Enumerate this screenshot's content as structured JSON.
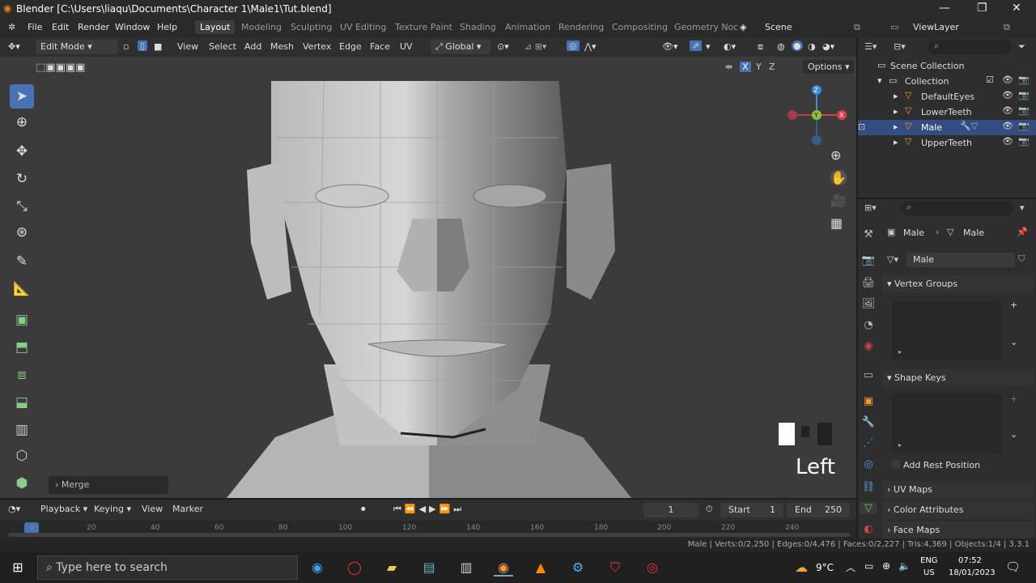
{
  "window": {
    "title": "Blender [C:\\Users\\liaqu\\Documents\\Character 1\\Male1\\Tut.blend]",
    "minimize": "—",
    "maximize": "❐",
    "close": "✕"
  },
  "menu": [
    "File",
    "Edit",
    "Render",
    "Window",
    "Help"
  ],
  "workspaces": [
    "Layout",
    "Modeling",
    "Sculpting",
    "UV Editing",
    "Texture Paint",
    "Shading",
    "Animation",
    "Rendering",
    "Compositing",
    "Geometry Noc"
  ],
  "scene": "Scene",
  "view_layer": "ViewLayer",
  "header3d": {
    "mode": "Edit Mode",
    "menus": [
      "View",
      "Select",
      "Add",
      "Mesh",
      "Vertex",
      "Edge",
      "Face",
      "UV"
    ],
    "transform": "Global",
    "options": "Options",
    "x": "X",
    "y": "Y",
    "z": "Z"
  },
  "viewport": {
    "view_label": "Left",
    "operator": "Merge"
  },
  "outliner": {
    "root": "Scene Collection",
    "collection": "Collection",
    "items": [
      {
        "name": "DefaultEyes"
      },
      {
        "name": "LowerTeeth"
      },
      {
        "name": "Male"
      },
      {
        "name": "UpperTeeth"
      }
    ]
  },
  "properties": {
    "breadcrumb_object": "Male",
    "breadcrumb_data": "Male",
    "mesh_name": "Male",
    "panels": [
      "Vertex Groups",
      "Shape Keys",
      "UV Maps",
      "Color Attributes",
      "Face Maps"
    ],
    "add_rest_position": "Add Rest Position"
  },
  "timeline": {
    "menus": [
      "Playback",
      "Keying",
      "View",
      "Marker"
    ],
    "current_frame": "1",
    "start_label": "Start",
    "start": "1",
    "end_label": "End",
    "end": "250",
    "ticks": [
      "0",
      "20",
      "40",
      "60",
      "80",
      "100",
      "120",
      "140",
      "160",
      "180",
      "200",
      "220",
      "240"
    ]
  },
  "status": "Male | Verts:0/2,250 | Edges:0/4,476 | Faces:0/2,227 | Tris:4,369 | Objects:1/4 | 3.3.1",
  "taskbar": {
    "search_placeholder": "Type here to search",
    "temperature": "9°C",
    "lang_top": "ENG",
    "lang_bottom": "US",
    "time": "07:52",
    "date": "18/01/2023"
  }
}
